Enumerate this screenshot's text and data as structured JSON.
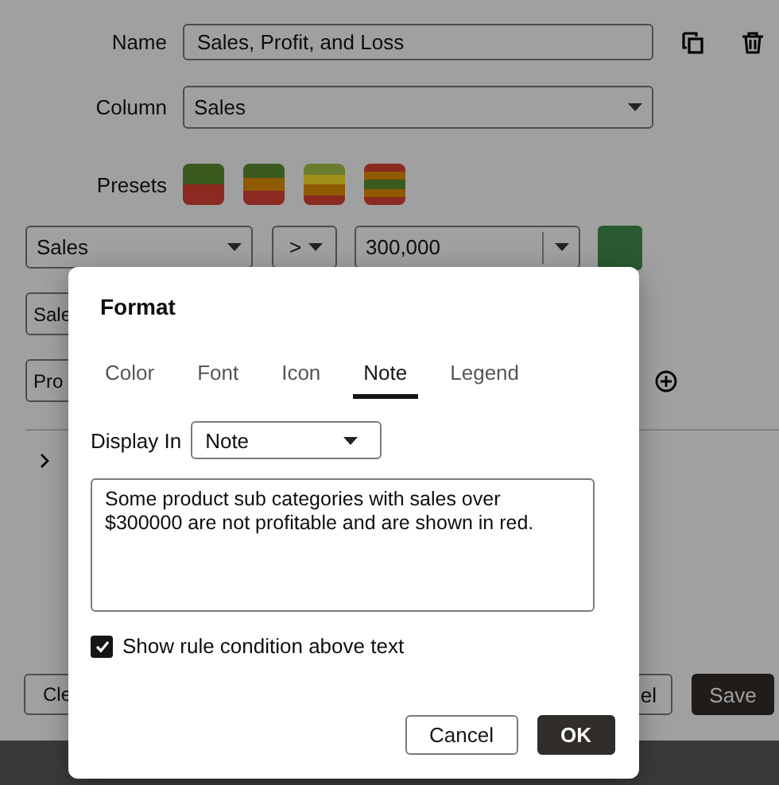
{
  "background": {
    "name_field": {
      "label": "Name",
      "value": "Sales, Profit, and Loss"
    },
    "column_field": {
      "label": "Column",
      "value": "Sales"
    },
    "presets": {
      "label": "Presets",
      "swatches": [
        {
          "bands": [
            {
              "color": "#3a5a1e"
            },
            {
              "color": "#8a2a20"
            }
          ]
        },
        {
          "bands": [
            {
              "color": "#3a5a1e"
            },
            {
              "color": "#8f5a00"
            },
            {
              "color": "#8a2a20"
            }
          ]
        },
        {
          "bands": [
            {
              "color": "#6a7c30"
            },
            {
              "color": "#a09018"
            },
            {
              "color": "#8f5a00"
            },
            {
              "color": "#8a2a20"
            }
          ]
        },
        {
          "bands": [
            {
              "color": "#8a2a20"
            },
            {
              "color": "#8f5a00"
            },
            {
              "color": "#3a5a1e"
            },
            {
              "color": "#8f5a00"
            },
            {
              "color": "#8a2a20"
            }
          ]
        }
      ]
    },
    "rules": [
      {
        "column": "Sales",
        "operator": ">",
        "value": "300,000",
        "color": "#2a5a30"
      },
      {
        "column": "Sale"
      },
      {
        "column": "Pro"
      }
    ],
    "buttons": [
      {
        "label": "Cle",
        "kind": "secondary"
      },
      {
        "label": "el",
        "kind": "secondary"
      },
      {
        "label": "Save",
        "kind": "primary"
      }
    ]
  },
  "dialog": {
    "title": "Format",
    "tabs": [
      {
        "label": "Color",
        "selected": false
      },
      {
        "label": "Font",
        "selected": false
      },
      {
        "label": "Icon",
        "selected": false
      },
      {
        "label": "Note",
        "selected": true
      },
      {
        "label": "Legend",
        "selected": false
      }
    ],
    "display_in": {
      "label": "Display In",
      "value": "Note"
    },
    "note": "Some product sub categories with sales over $300000 are not profitable and are shown in red.",
    "show_condition": {
      "label": "Show rule condition above text",
      "checked": true
    },
    "buttons": [
      {
        "label": "Cancel",
        "kind": "secondary"
      },
      {
        "label": "OK",
        "kind": "primary"
      }
    ]
  }
}
